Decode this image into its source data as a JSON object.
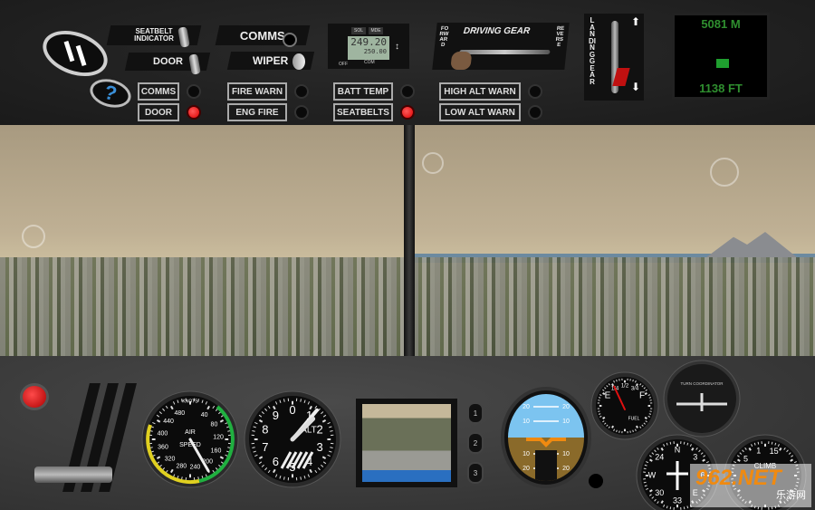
{
  "top_panel": {
    "pause_icon": "pause-icon",
    "help_icon": "question-icon",
    "switches": {
      "seatbelt_indicator": "SEATBELT INDICATOR",
      "door": "DOOR",
      "comms": "COMMS",
      "wiper": "WIPER"
    },
    "radio": {
      "sol": "SOL",
      "mde": "MDE",
      "active": "249.20",
      "standby": "250.00",
      "off": "OFF",
      "com": "COM"
    },
    "warnings": [
      {
        "label": "COMMS",
        "lit": false
      },
      {
        "label": "DOOR",
        "lit": true
      },
      {
        "label": "FIRE WARN",
        "lit": false
      },
      {
        "label": "ENG FIRE",
        "lit": false
      },
      {
        "label": "BATT TEMP",
        "lit": false
      },
      {
        "label": "SEATBELTS",
        "lit": true
      },
      {
        "label": "HIGH ALT WARN",
        "lit": false
      },
      {
        "label": "LOW ALT WARN",
        "lit": false
      }
    ],
    "driving_gear": {
      "title": "DRIVING GEAR",
      "forward": "FORWARD",
      "reverse": "REVERSE"
    },
    "landing_gear": {
      "label": "LANDING GEAR",
      "position": "down"
    },
    "altitude": {
      "meters": "5081 M",
      "feet": "1138 FT"
    }
  },
  "instruments": {
    "airspeed": {
      "title": "KNOTS",
      "label1": "AIR",
      "label2": "SPEED",
      "ticks": [
        "40",
        "80",
        "120",
        "160",
        "200",
        "240",
        "280",
        "320",
        "360",
        "400",
        "440",
        "480"
      ]
    },
    "altimeter": {
      "label": "ALT",
      "ticks": [
        "0",
        "1",
        "2",
        "3",
        "4",
        "5",
        "6",
        "7",
        "8",
        "9"
      ]
    },
    "camera_buttons": [
      "1",
      "2",
      "3"
    ],
    "attitude": {
      "marks": [
        "20",
        "10",
        "10",
        "20"
      ]
    },
    "fuel": {
      "e": "E",
      "q1": "1/4",
      "half": "1/2",
      "q3": "3/4",
      "f": "F",
      "label": "FUEL"
    },
    "turn_coordinator": {
      "label": "TURN COORDINATOR"
    },
    "heading": {
      "ticks": [
        "N",
        "3",
        "6",
        "E",
        "33",
        "30",
        "W",
        "24"
      ]
    },
    "climb": {
      "label": "CLIMB",
      "ticks": [
        "5",
        "1",
        "15"
      ]
    }
  },
  "watermark": {
    "text": "962.NET",
    "sub": "乐游网"
  },
  "colors": {
    "warning_red": "#e01010",
    "lcd_green": "#2f8f2f",
    "sky": "#7cc4f0",
    "ground": "#8a6a2a"
  }
}
